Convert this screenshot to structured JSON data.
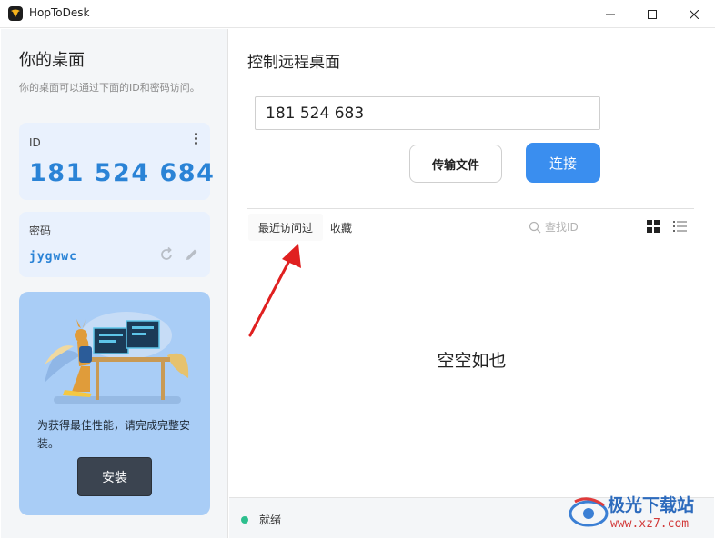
{
  "window": {
    "title": "HopToDesk"
  },
  "sidebar": {
    "title": "你的桌面",
    "subtitle": "你的桌面可以通过下面的ID和密码访问。",
    "id_label": "ID",
    "id_value": "181 524 684",
    "password_label": "密码",
    "password_value": "jygwwc",
    "promo_text": "为获得最佳性能，请完成完整安装。",
    "install_label": "安装"
  },
  "main": {
    "title": "控制远程桌面",
    "remote_id_value": "181 524 683",
    "transfer_label": "传输文件",
    "connect_label": "连接",
    "tabs": [
      {
        "label": "最近访问过",
        "active": true
      },
      {
        "label": "收藏",
        "active": false
      }
    ],
    "search_placeholder": "查找ID",
    "empty_text": "空空如也"
  },
  "status": {
    "text": "就绪",
    "color": "#2cbf8e"
  },
  "watermark": {
    "line1": "极光下载站",
    "line2": "www.xz7.com"
  },
  "colors": {
    "accent": "#3a8eef",
    "id_text": "#2a83d6",
    "promo_bg": "#a9cdf6",
    "annotation": "#e02020"
  },
  "icons": [
    "app-icon",
    "minimize-icon",
    "maximize-icon",
    "close-icon",
    "more-icon",
    "refresh-icon",
    "edit-icon",
    "search-icon",
    "grid-view-icon",
    "list-view-icon"
  ]
}
